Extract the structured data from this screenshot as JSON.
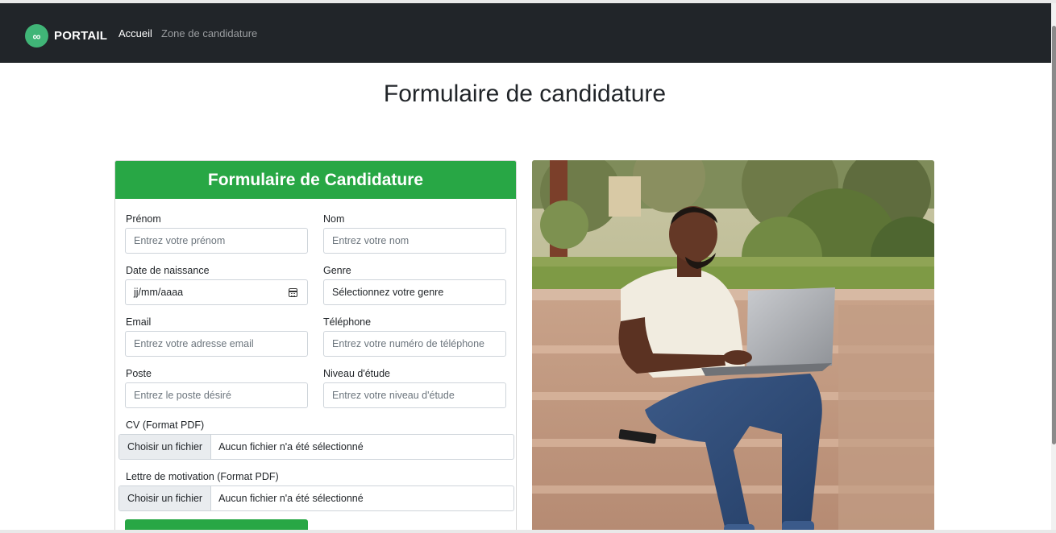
{
  "navbar": {
    "brand": "PORTAIL",
    "logo_glyph": "∞",
    "links": [
      {
        "label": "Accueil",
        "active": true
      },
      {
        "label": "Zone de candidature",
        "active": false
      }
    ]
  },
  "page": {
    "title": "Formulaire de candidature"
  },
  "form": {
    "header": "Formulaire de Candidature",
    "fields": {
      "prenom": {
        "label": "Prénom",
        "placeholder": "Entrez votre prénom"
      },
      "nom": {
        "label": "Nom",
        "placeholder": "Entrez votre nom"
      },
      "date": {
        "label": "Date de naissance",
        "value": "jj/mm/aaaa"
      },
      "genre": {
        "label": "Genre",
        "value": "Sélectionnez votre genre"
      },
      "email": {
        "label": "Email",
        "placeholder": "Entrez votre adresse email"
      },
      "telephone": {
        "label": "Téléphone",
        "placeholder": "Entrez votre numéro de téléphone"
      },
      "poste": {
        "label": "Poste",
        "placeholder": "Entrez le poste désiré"
      },
      "niveau": {
        "label": "Niveau d'étude",
        "placeholder": "Entrez votre niveau d'étude"
      },
      "cv": {
        "label": "CV (Format PDF)",
        "button": "Choisir un fichier",
        "status": "Aucun fichier n'a été sélectionné"
      },
      "lettre": {
        "label": "Lettre de motivation (Format PDF)",
        "button": "Choisir un fichier",
        "status": "Aucun fichier n'a été sélectionné"
      }
    }
  },
  "colors": {
    "navbar_bg": "#212529",
    "brand_logo": "#40b577",
    "primary_green": "#28a745"
  },
  "icons": {
    "calendar": "calendar-icon",
    "logo": "infinity-logo-icon"
  }
}
